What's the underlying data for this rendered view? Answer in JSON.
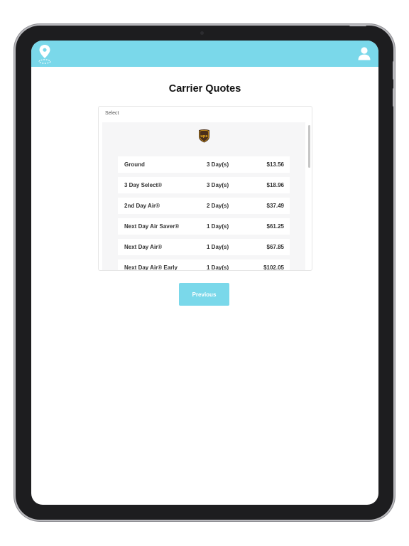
{
  "page": {
    "title": "Carrier Quotes"
  },
  "select": {
    "label": "Select",
    "carrier": "ups",
    "options": [
      {
        "service": "Ground",
        "days": "3 Day(s)",
        "price": "$13.56"
      },
      {
        "service": "3 Day Select®",
        "days": "3 Day(s)",
        "price": "$18.96"
      },
      {
        "service": "2nd Day Air®",
        "days": "2 Day(s)",
        "price": "$37.49"
      },
      {
        "service": "Next Day Air Saver®",
        "days": "1 Day(s)",
        "price": "$61.25"
      },
      {
        "service": "Next Day Air®",
        "days": "1 Day(s)",
        "price": "$67.85"
      },
      {
        "service": "Next Day Air® Early",
        "days": "1 Day(s)",
        "price": "$102.05"
      }
    ]
  },
  "buttons": {
    "previous_label": "Previous"
  },
  "colors": {
    "accent": "#7ad8ea",
    "carrier_brown": "#4a2f1b",
    "carrier_gold": "#f3b41b"
  },
  "icons": {
    "app_logo": "location-pin-icon",
    "profile": "user-icon"
  }
}
